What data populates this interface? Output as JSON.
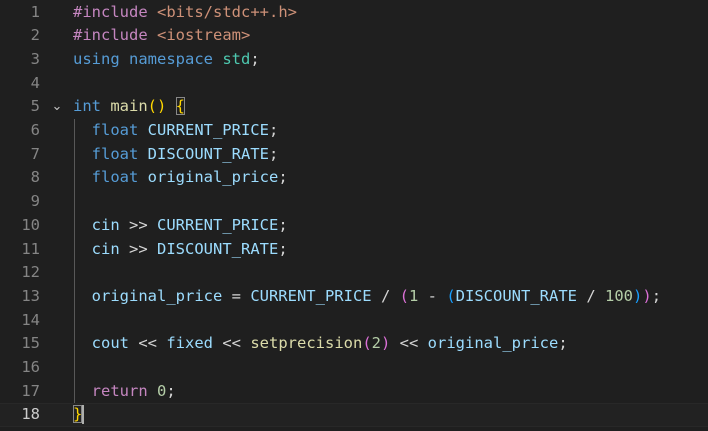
{
  "editor": {
    "current_line": 18,
    "lines": [
      {
        "n": "1",
        "segs": [
          [
            "#include ",
            "t-dir"
          ],
          [
            "<bits/stdc++.h>",
            "t-inc"
          ]
        ]
      },
      {
        "n": "2",
        "segs": [
          [
            "#include ",
            "t-dir"
          ],
          [
            "<iostream>",
            "t-inc"
          ]
        ]
      },
      {
        "n": "3",
        "segs": [
          [
            "using ",
            "t-kw"
          ],
          [
            "namespace ",
            "t-kw"
          ],
          [
            "std",
            "t-ns"
          ],
          [
            ";",
            "t-plain"
          ]
        ]
      },
      {
        "n": "4",
        "segs": []
      },
      {
        "n": "5",
        "fold": "⌄",
        "segs": [
          [
            "int ",
            "t-kw"
          ],
          [
            "main",
            "t-fn"
          ],
          [
            "() ",
            "t-p1"
          ],
          [
            "{",
            "t-p1 bm"
          ]
        ]
      },
      {
        "n": "6",
        "segs": [
          [
            "  float ",
            "t-kw"
          ],
          [
            "CURRENT_PRICE",
            "t-var"
          ],
          [
            ";",
            "t-plain"
          ]
        ]
      },
      {
        "n": "7",
        "segs": [
          [
            "  float ",
            "t-kw"
          ],
          [
            "DISCOUNT_RATE",
            "t-var"
          ],
          [
            ";",
            "t-plain"
          ]
        ]
      },
      {
        "n": "8",
        "segs": [
          [
            "  float ",
            "t-kw"
          ],
          [
            "original_price",
            "t-var"
          ],
          [
            ";",
            "t-plain"
          ]
        ]
      },
      {
        "n": "9",
        "segs": []
      },
      {
        "n": "10",
        "segs": [
          [
            "  cin ",
            "t-var"
          ],
          [
            ">> ",
            "t-plain"
          ],
          [
            "CURRENT_PRICE",
            "t-var"
          ],
          [
            ";",
            "t-plain"
          ]
        ]
      },
      {
        "n": "11",
        "segs": [
          [
            "  cin ",
            "t-var"
          ],
          [
            ">> ",
            "t-plain"
          ],
          [
            "DISCOUNT_RATE",
            "t-var"
          ],
          [
            ";",
            "t-plain"
          ]
        ]
      },
      {
        "n": "12",
        "segs": []
      },
      {
        "n": "13",
        "segs": [
          [
            "  original_price ",
            "t-var"
          ],
          [
            "= ",
            "t-plain"
          ],
          [
            "CURRENT_PRICE ",
            "t-var"
          ],
          [
            "/ ",
            "t-plain"
          ],
          [
            "(",
            "t-p2"
          ],
          [
            "1 ",
            "t-num"
          ],
          [
            "- ",
            "t-plain"
          ],
          [
            "(",
            "t-p3"
          ],
          [
            "DISCOUNT_RATE ",
            "t-var"
          ],
          [
            "/ ",
            "t-plain"
          ],
          [
            "100",
            "t-num"
          ],
          [
            ")",
            "t-p3"
          ],
          [
            ")",
            "t-p2"
          ],
          [
            ";",
            "t-plain"
          ]
        ]
      },
      {
        "n": "14",
        "segs": []
      },
      {
        "n": "15",
        "segs": [
          [
            "  cout ",
            "t-var"
          ],
          [
            "<< ",
            "t-plain"
          ],
          [
            "fixed ",
            "t-var"
          ],
          [
            "<< ",
            "t-plain"
          ],
          [
            "setprecision",
            "t-fn"
          ],
          [
            "(",
            "t-p2"
          ],
          [
            "2",
            "t-num"
          ],
          [
            ") ",
            "t-p2"
          ],
          [
            "<< ",
            "t-plain"
          ],
          [
            "original_price",
            "t-var"
          ],
          [
            ";",
            "t-plain"
          ]
        ]
      },
      {
        "n": "16",
        "segs": []
      },
      {
        "n": "17",
        "segs": [
          [
            "  return ",
            "t-ctl"
          ],
          [
            "0",
            "t-num"
          ],
          [
            ";",
            "t-plain"
          ]
        ]
      },
      {
        "n": "18",
        "segs": [
          [
            "}",
            "t-p1 bm"
          ]
        ]
      }
    ]
  }
}
